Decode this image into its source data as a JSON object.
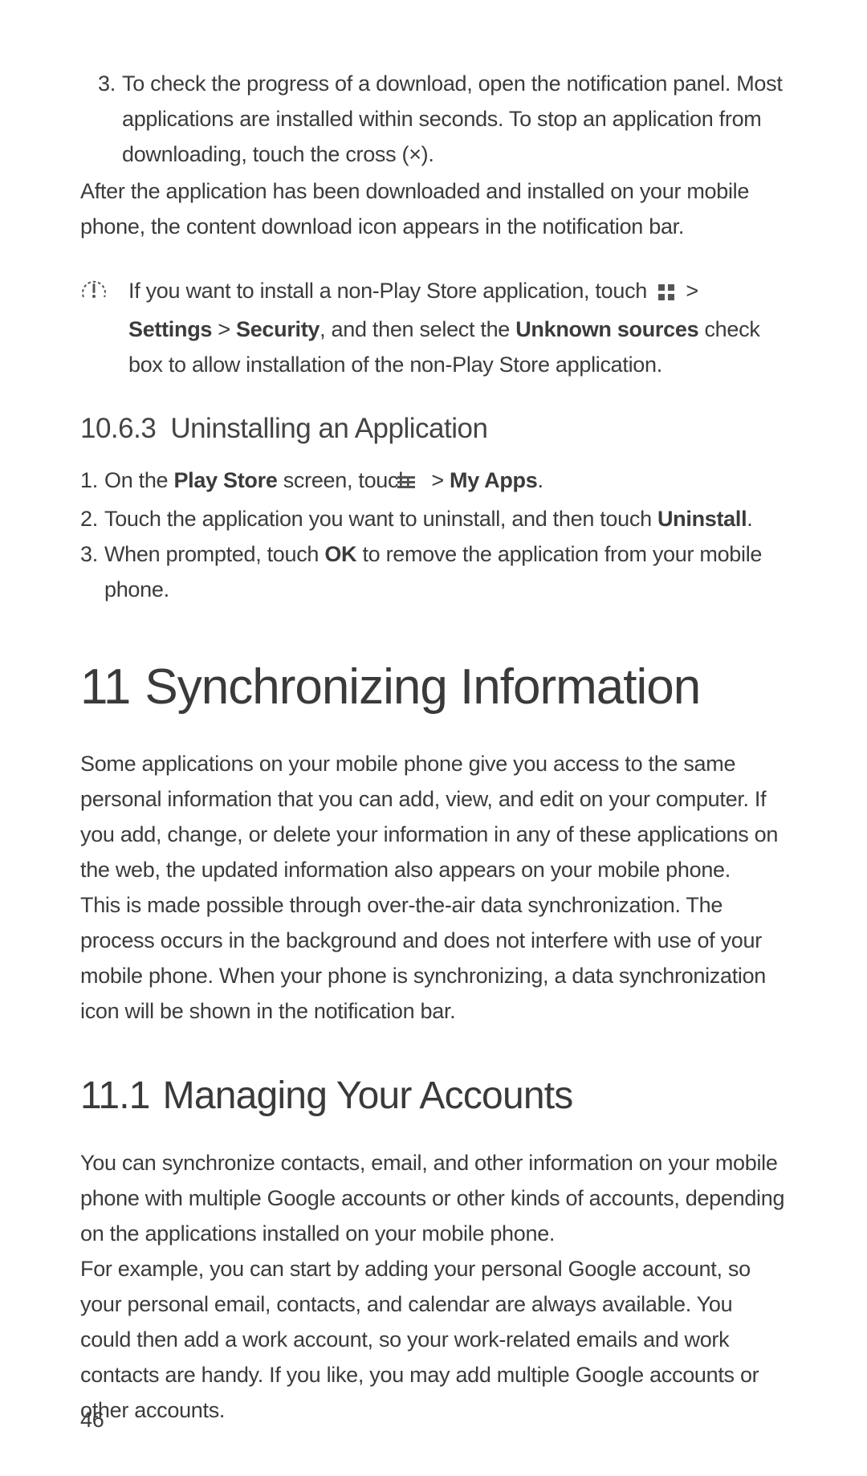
{
  "section_prev": {
    "step3": "To check the progress of a download, open the notification panel. Most applications are installed within seconds. To stop an application from downloading, touch the cross (×).",
    "after": "After the application has been downloaded and installed on your mobile phone, the content download icon appears in the notification bar."
  },
  "note": {
    "icon_name": "caution-icon",
    "p1a": "If you want to install a non-Play Store application, touch ",
    "p1b": " > ",
    "p1c_bold": "Settings",
    "p1d": " > ",
    "p1e_bold": "Security",
    "p1f": ", and then select the ",
    "p1g_bold": "Unknown sources",
    "p1h": " check box to allow installation of the non-Play Store application."
  },
  "s10_6_3": {
    "number": "10.6.3",
    "title": "Uninstalling an Application",
    "step1a": "On the ",
    "step1b_bold": "Play Store",
    "step1c": " screen, touch ",
    "step1d": " > ",
    "step1e_bold": "My Apps",
    "step1f": ".",
    "step2a": "Touch the application you want to uninstall, and then touch ",
    "step2b_bold": "Uninstall",
    "step2c": ".",
    "step3a": "When prompted, touch ",
    "step3b_bold": "OK",
    "step3c": " to remove the application from your mobile phone."
  },
  "s11": {
    "number": "11",
    "title": "Synchronizing Information",
    "p1": "Some applications on your mobile phone give you access to the same personal information that you can add, view, and edit on your computer. If you add, change, or delete your information in any of these applications on the web, the updated information also appears on your mobile phone.",
    "p2": "This is made possible through over-the-air data synchronization. The process occurs in the background and does not interfere with use of your mobile phone. When your phone is synchronizing, a data synchronization icon will be shown in the notification bar."
  },
  "s11_1": {
    "number": "11.1",
    "title": "Managing Your Accounts",
    "p1": "You can synchronize contacts, email, and other information on your mobile phone with multiple Google accounts or other kinds of accounts, depending on the applications installed on your mobile phone.",
    "p2": "For example, you can start by adding your personal Google account, so your personal email, contacts, and calendar are always available. You could then add a work account, so your work-related emails and work contacts are handy. If you like, you may add multiple Google accounts or other accounts."
  },
  "page_number": "46"
}
